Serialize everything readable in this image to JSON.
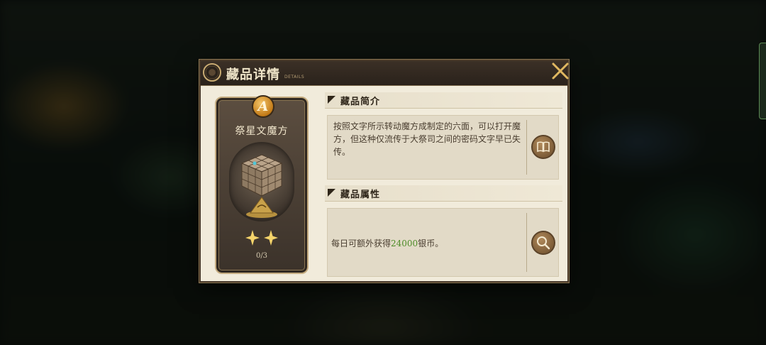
{
  "dialog": {
    "title": "藏品详情",
    "title_sub": "DETAILS"
  },
  "card": {
    "grade": "A",
    "name": "祭星文魔方",
    "stars": 2,
    "progress": "0/3"
  },
  "intro": {
    "heading": "藏品简介",
    "text": "按照文字所示转动魔方成制定的六面，可以打开魔方，但这种仅流传于大祭司之间的密码文字早已失传。",
    "icon": "book-icon"
  },
  "attributes": {
    "heading": "藏品属性",
    "text_before": "每日可额外获得",
    "amount": "24000",
    "text_after": "银币。",
    "icon": "magnifier-icon"
  },
  "colors": {
    "highlight": "#4e8c28",
    "gold": "#e0b860"
  }
}
